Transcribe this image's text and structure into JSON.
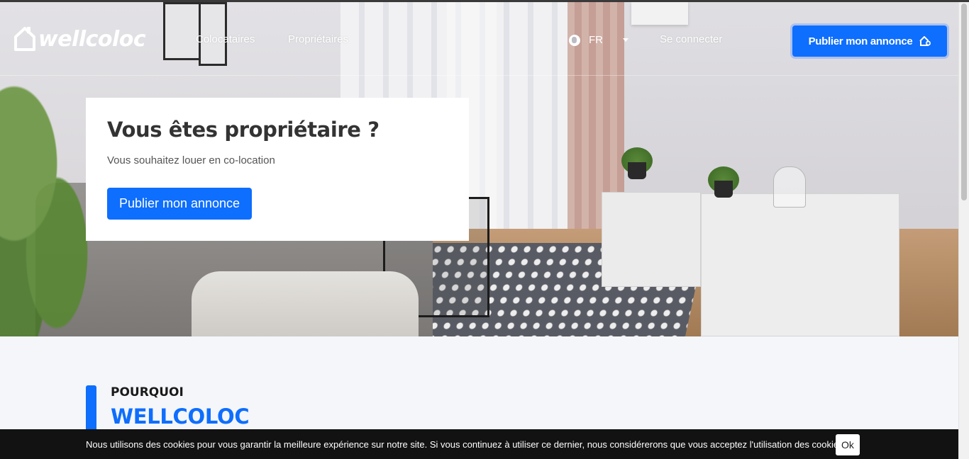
{
  "nav": {
    "logo_text": "wellcoloc",
    "links": [
      {
        "label": "Colocataires"
      },
      {
        "label": "Propriétaires"
      }
    ],
    "language": "FR",
    "login_label": "Se connecter",
    "cta_label": "Publier mon annonce"
  },
  "hero": {
    "title": "Vous êtes propriétaire ?",
    "subtitle": "Vous souhaitez louer en co-location",
    "button_label": "Publier mon annonce"
  },
  "section": {
    "kicker": "POURQUOI",
    "title": "WELLCOLOC"
  },
  "cookie": {
    "text": "Nous utilisons des cookies pour vous garantir la meilleure expérience sur notre site.   Si vous continuez à utiliser ce dernier, nous considérerons que vous acceptez l'utilisation des cookies.",
    "button_label": "Ok"
  },
  "colors": {
    "accent": "#0e6efd",
    "cookie_bg": "#121212",
    "section_bg": "#f4f6fa"
  },
  "icons": [
    "house-logo-icon",
    "globe-icon",
    "chevron-down-icon",
    "house-plus-icon"
  ]
}
